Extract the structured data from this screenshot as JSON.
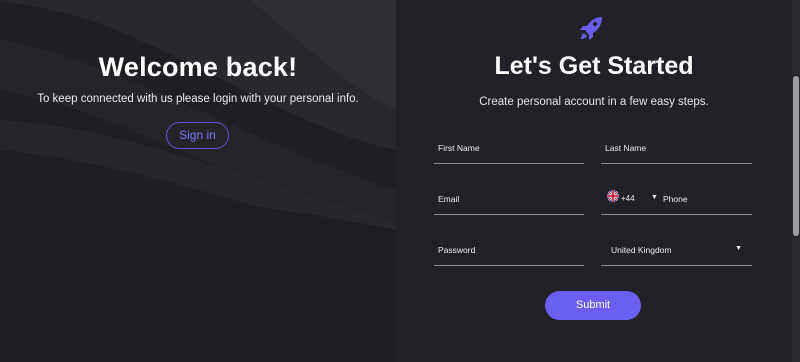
{
  "left": {
    "title": "Welcome back!",
    "subtitle": "To keep connected with us please login with your personal info.",
    "signin_label": "Sign in"
  },
  "right": {
    "title": "Let's Get Started",
    "subtitle": "Create personal account in a few easy steps.",
    "fields": {
      "first_name": "First Name",
      "last_name": "Last Name",
      "email": "Email",
      "country_code": "+44",
      "phone": "Phone",
      "password": "Password",
      "country": "United Kingdom"
    },
    "submit_label": "Submit"
  },
  "colors": {
    "accent": "#6a5ff2",
    "background": "#222127"
  },
  "icons": {
    "logo": "rocket-icon",
    "flag": "uk-flag-icon"
  }
}
